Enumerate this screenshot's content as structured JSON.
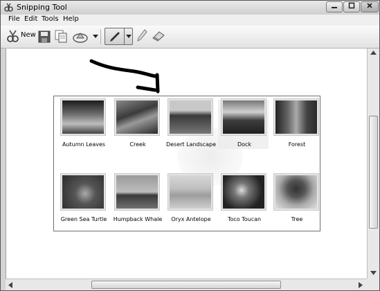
{
  "window": {
    "title": "Snipping Tool"
  },
  "menu": [
    "File",
    "Edit",
    "Tools",
    "Help"
  ],
  "toolbar": {
    "new_label": "New"
  },
  "gallery": {
    "items": [
      {
        "label": "Autumn Leaves"
      },
      {
        "label": "Creek"
      },
      {
        "label": "Desert Landscape"
      },
      {
        "label": "Dock"
      },
      {
        "label": "Forest"
      },
      {
        "label": "Green Sea Turtle"
      },
      {
        "label": "Humpback Whale"
      },
      {
        "label": "Oryx Antelope"
      },
      {
        "label": "Toco Toucan"
      },
      {
        "label": "Tree"
      }
    ]
  },
  "icons": [
    "app-scissors-icon",
    "new-snip-icon",
    "save-icon",
    "copy-icon",
    "send-snip-icon",
    "send-dropdown-icon",
    "pen-icon",
    "pen-dropdown-icon",
    "highlighter-icon",
    "eraser-icon",
    "drawn-arrow"
  ],
  "colors": {
    "titlebar": "#dcdcdc",
    "canvas": "#ffffff",
    "ink": "#000000"
  }
}
